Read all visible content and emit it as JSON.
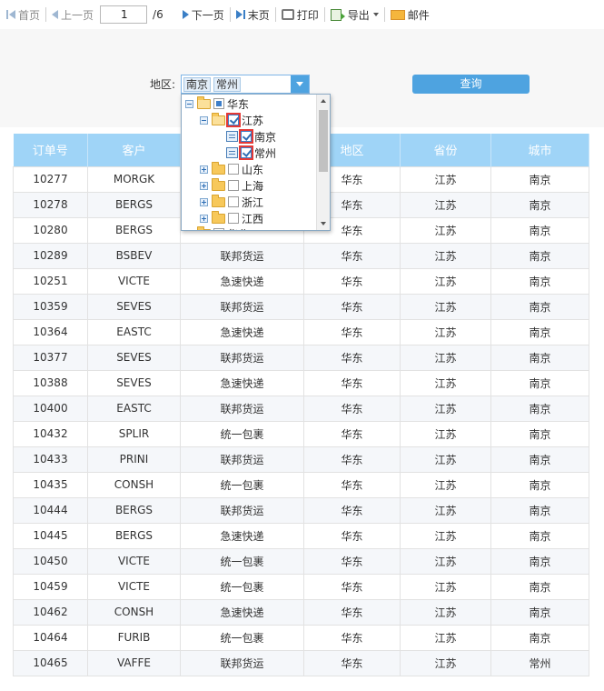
{
  "toolbar": {
    "first": "首页",
    "prev": "上一页",
    "page_value": "1",
    "page_total": "/6",
    "next": "下一页",
    "last": "末页",
    "print": "打印",
    "export": "导出",
    "mail": "邮件"
  },
  "query": {
    "region_label": "地区:",
    "selected_tags": [
      "南京",
      "常州"
    ],
    "query_button": "查询"
  },
  "tree": {
    "items": [
      {
        "label": "华东",
        "state": "partial",
        "expanded": true
      },
      {
        "label": "江苏",
        "state": "checked",
        "expanded": true
      },
      {
        "label": "南京",
        "state": "checked",
        "leaf": true
      },
      {
        "label": "常州",
        "state": "checked",
        "leaf": true
      },
      {
        "label": "山东",
        "state": "unchecked",
        "expanded": false
      },
      {
        "label": "上海",
        "state": "unchecked",
        "expanded": false
      },
      {
        "label": "浙江",
        "state": "unchecked",
        "expanded": false
      },
      {
        "label": "江西",
        "state": "unchecked",
        "expanded": false
      },
      {
        "label": "华北",
        "state": "unchecked",
        "expanded": false
      }
    ]
  },
  "table": {
    "headers": [
      "订单号",
      "客户",
      "",
      "地区",
      "省份",
      "城市"
    ],
    "rows": [
      [
        "10277",
        "MORGK",
        "",
        "华东",
        "江苏",
        "南京"
      ],
      [
        "10278",
        "BERGS",
        "",
        "华东",
        "江苏",
        "南京"
      ],
      [
        "10280",
        "BERGS",
        "",
        "华东",
        "江苏",
        "南京"
      ],
      [
        "10289",
        "BSBEV",
        "联邦货运",
        "华东",
        "江苏",
        "南京"
      ],
      [
        "10251",
        "VICTE",
        "急速快递",
        "华东",
        "江苏",
        "南京"
      ],
      [
        "10359",
        "SEVES",
        "联邦货运",
        "华东",
        "江苏",
        "南京"
      ],
      [
        "10364",
        "EASTC",
        "急速快递",
        "华东",
        "江苏",
        "南京"
      ],
      [
        "10377",
        "SEVES",
        "联邦货运",
        "华东",
        "江苏",
        "南京"
      ],
      [
        "10388",
        "SEVES",
        "急速快递",
        "华东",
        "江苏",
        "南京"
      ],
      [
        "10400",
        "EASTC",
        "联邦货运",
        "华东",
        "江苏",
        "南京"
      ],
      [
        "10432",
        "SPLIR",
        "统一包裹",
        "华东",
        "江苏",
        "南京"
      ],
      [
        "10433",
        "PRINI",
        "联邦货运",
        "华东",
        "江苏",
        "南京"
      ],
      [
        "10435",
        "CONSH",
        "统一包裹",
        "华东",
        "江苏",
        "南京"
      ],
      [
        "10444",
        "BERGS",
        "联邦货运",
        "华东",
        "江苏",
        "南京"
      ],
      [
        "10445",
        "BERGS",
        "急速快递",
        "华东",
        "江苏",
        "南京"
      ],
      [
        "10450",
        "VICTE",
        "统一包裹",
        "华东",
        "江苏",
        "南京"
      ],
      [
        "10459",
        "VICTE",
        "统一包裹",
        "华东",
        "江苏",
        "南京"
      ],
      [
        "10462",
        "CONSH",
        "急速快递",
        "华东",
        "江苏",
        "南京"
      ],
      [
        "10464",
        "FURIB",
        "统一包裹",
        "华东",
        "江苏",
        "南京"
      ],
      [
        "10465",
        "VAFFE",
        "联邦货运",
        "华东",
        "江苏",
        "常州"
      ]
    ]
  }
}
